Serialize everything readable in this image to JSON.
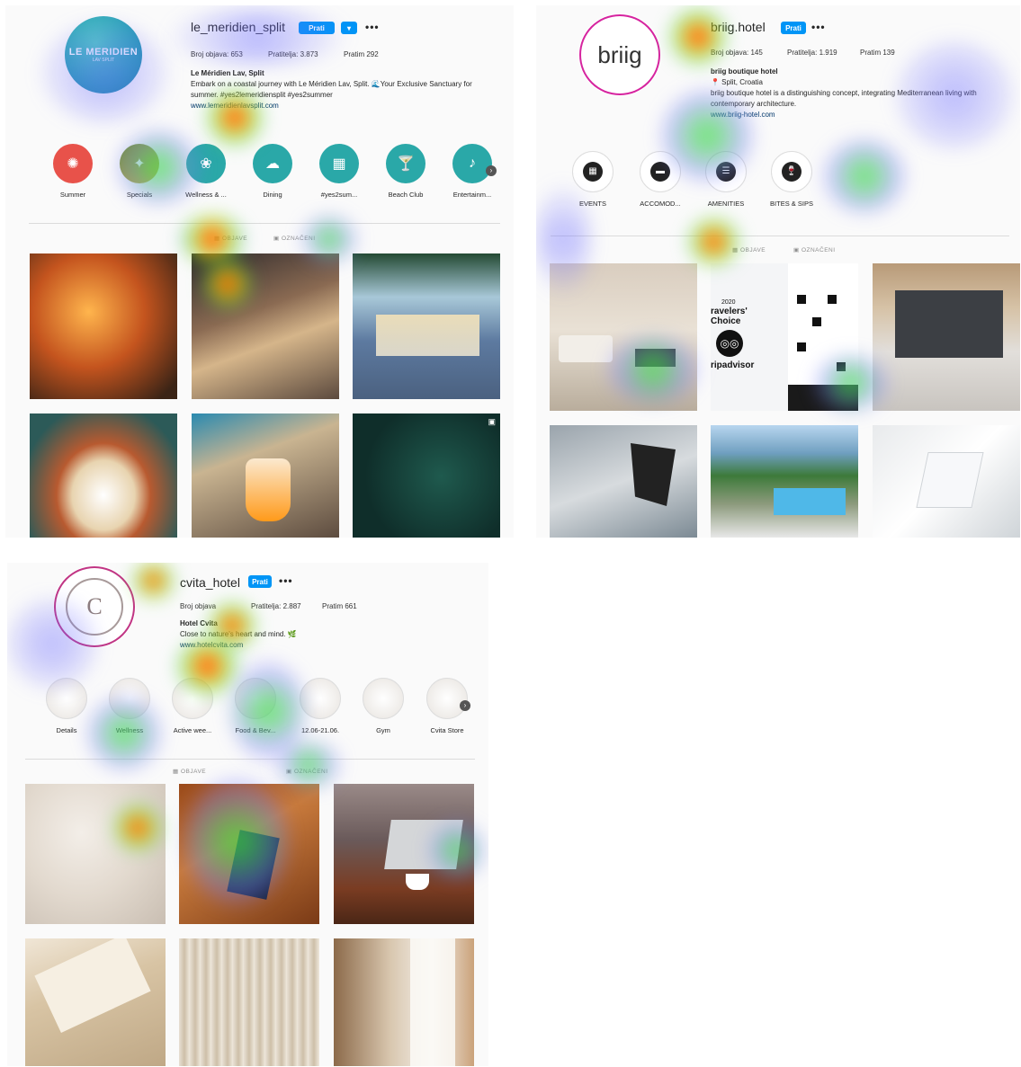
{
  "p1": {
    "username": "le_meridien_split",
    "follow_label": "Prati",
    "more_label": "•••",
    "stats": {
      "posts": "Broj objava: 653",
      "followers": "Pratitelja: 3.873",
      "following": "Pratim 292"
    },
    "bio": {
      "name": "Le Méridien Lav, Split",
      "line1": "Embark on a coastal journey with Le Méridien Lav, Split. 🌊Your Exclusive Sanctuary for",
      "line2": "summer. #yes2lemeridiensplit #yes2summer",
      "link": "www.lemeridienlavsplit.com"
    },
    "avatar_text": "LE MERIDIEN",
    "avatar_sub": "LAV SPLIT",
    "highlights": [
      "Summer",
      "Specials",
      "Wellness & ...",
      "Dining",
      "#yes2sum...",
      "Beach Club",
      "Entertainm..."
    ],
    "tabs": {
      "posts": "OBJAVE",
      "tagged": "OZNAČENI"
    },
    "colors": {
      "summer": "#e8524a",
      "teal": "#2aa8a8"
    }
  },
  "p2": {
    "username": "briig.hotel",
    "follow_label": "Prati",
    "more_label": "•••",
    "stats": {
      "posts": "Broj objava: 145",
      "followers": "Pratitelja: 1.919",
      "following": "Pratim 139"
    },
    "bio": {
      "name": "briig boutique hotel",
      "location": "📍 Split, Croatia",
      "line1": "briig boutique hotel is a distinguishing concept, integrating Mediterranean living with",
      "line2": "contemporary architecture.",
      "link": "www.briig-hotel.com"
    },
    "avatar_text": "briig",
    "highlights": [
      "EVENTS",
      "ACCOMOD...",
      "AMENITIES",
      "BITES & SIPS"
    ],
    "tabs": {
      "posts": "OBJAVE",
      "tagged": "OZNAČENI"
    },
    "tile_text": {
      "year": "2020",
      "t1": "ravelers'",
      "t2": "Choice",
      "brand": "ripadvisor"
    }
  },
  "p3": {
    "username": "cvita_hotel",
    "follow_label": "Prati",
    "more_label": "•••",
    "stats": {
      "posts": "Broj objava",
      "followers": "Pratitelja: 2.887",
      "following": "Pratim 661"
    },
    "bio": {
      "name": "Hotel Cvita",
      "line1": "Close to nature's heart and mind. 🌿",
      "link": "www.hotelcvita.com"
    },
    "avatar_text": "C",
    "highlights": [
      "Details",
      "Wellness",
      "Active wee...",
      "Food & Bev...",
      "12.06-21.06.",
      "Gym",
      "Cvita Store"
    ],
    "tabs": {
      "posts": "OBJAVE",
      "tagged": "OZNAČENI"
    }
  }
}
